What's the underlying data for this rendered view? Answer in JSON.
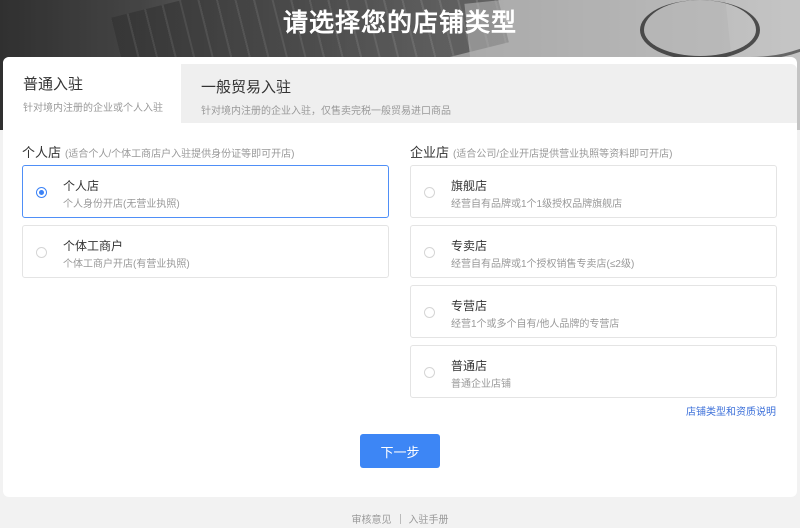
{
  "page": {
    "title": "请选择您的店铺类型"
  },
  "tabs": [
    {
      "title": "普通入驻",
      "subtitle": "针对境内注册的企业或个人入驻",
      "active": true
    },
    {
      "title": "一般贸易入驻",
      "subtitle": "针对境内注册的企业入驻，仅售卖完税一般贸易进口商品",
      "active": false
    }
  ],
  "personal": {
    "title": "个人店",
    "hint": "(适合个人/个体工商店户入驻提供身份证等即可开店)",
    "options": [
      {
        "title": "个人店",
        "desc": "个人身份开店(无营业执照)",
        "selected": true
      },
      {
        "title": "个体工商户",
        "desc": "个体工商户开店(有营业执照)",
        "selected": false
      }
    ]
  },
  "enterprise": {
    "title": "企业店",
    "hint": "(适合公司/企业开店提供营业执照等资料即可开店)",
    "options": [
      {
        "title": "旗舰店",
        "desc": "经营自有品牌或1个1级授权品牌旗舰店",
        "selected": false
      },
      {
        "title": "专卖店",
        "desc": "经营自有品牌或1个授权销售专卖店(≤2级)",
        "selected": false
      },
      {
        "title": "专营店",
        "desc": "经营1个或多个自有/他人品牌的专营店",
        "selected": false
      },
      {
        "title": "普通店",
        "desc": "普通企业店铺",
        "selected": false
      }
    ],
    "help_link": "店铺类型和资质说明"
  },
  "actions": {
    "next_label": "下一步"
  },
  "footer": {
    "links": [
      "审核意见",
      "入驻手册"
    ]
  },
  "colors": {
    "accent": "#3d86f5",
    "selected_border": "#4f8ff7",
    "link": "#3b6fd9"
  }
}
